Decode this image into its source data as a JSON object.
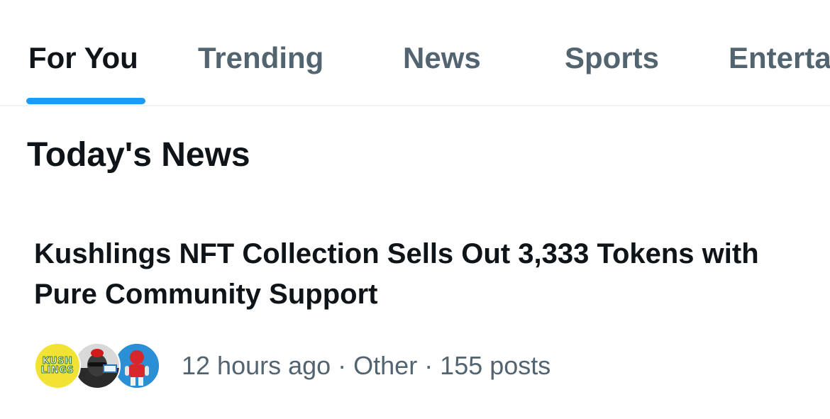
{
  "tabs": [
    {
      "label": "For You",
      "active": true
    },
    {
      "label": "Trending",
      "active": false
    },
    {
      "label": "News",
      "active": false
    },
    {
      "label": "Sports",
      "active": false
    },
    {
      "label": "Enterta",
      "active": false
    }
  ],
  "accent_color": "#1d9bf0",
  "section": {
    "title": "Today's News"
  },
  "story": {
    "headline": "Kushlings NFT Collection Sells Out 3,333 Tokens with Pure Community Support",
    "avatars": [
      {
        "name": "kushlings-logo-avatar",
        "logo_text": [
          "KUSH",
          "LINGS"
        ]
      },
      {
        "name": "user-avatar-2"
      },
      {
        "name": "user-avatar-3"
      }
    ],
    "meta": "12 hours ago · Other · 155 posts"
  }
}
